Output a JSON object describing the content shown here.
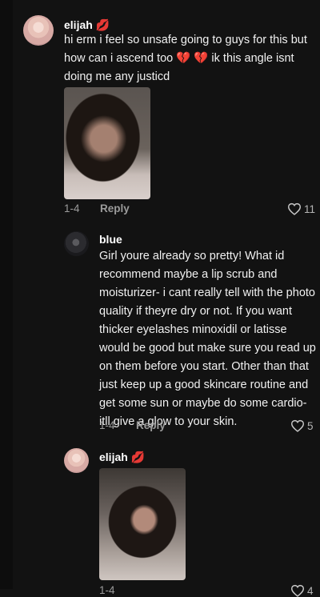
{
  "comments": [
    {
      "username": "elijah 💋",
      "text": "hi erm i feel so unsafe going to guys for this but how can i ascend too 💔 💔 ik this angle isnt doing me any justicd",
      "date": "1-4",
      "reply_label": "Reply",
      "likes": "11",
      "has_photo": true
    },
    {
      "username": "blue",
      "text": "Girl youre already so pretty! What id recommend maybe a lip scrub and moisturizer- i cant really tell with the photo quality if theyre dry or not. If you want thicker eyelashes minoxidil or latisse would be good but make sure you read up on them before you start. Other than that just keep up a good skincare routine and get some sun or maybe do some cardio- itll give a glow to your skin.",
      "date": "1-4",
      "reply_label": "Reply",
      "likes": "5"
    },
    {
      "username": "elijah 💋",
      "date": "1-4",
      "likes": "4",
      "has_photo": true
    }
  ],
  "icons": {
    "heart": "heart-outline-icon"
  },
  "colors": {
    "background": "#121212",
    "muted_text": "#9b9b9b"
  }
}
